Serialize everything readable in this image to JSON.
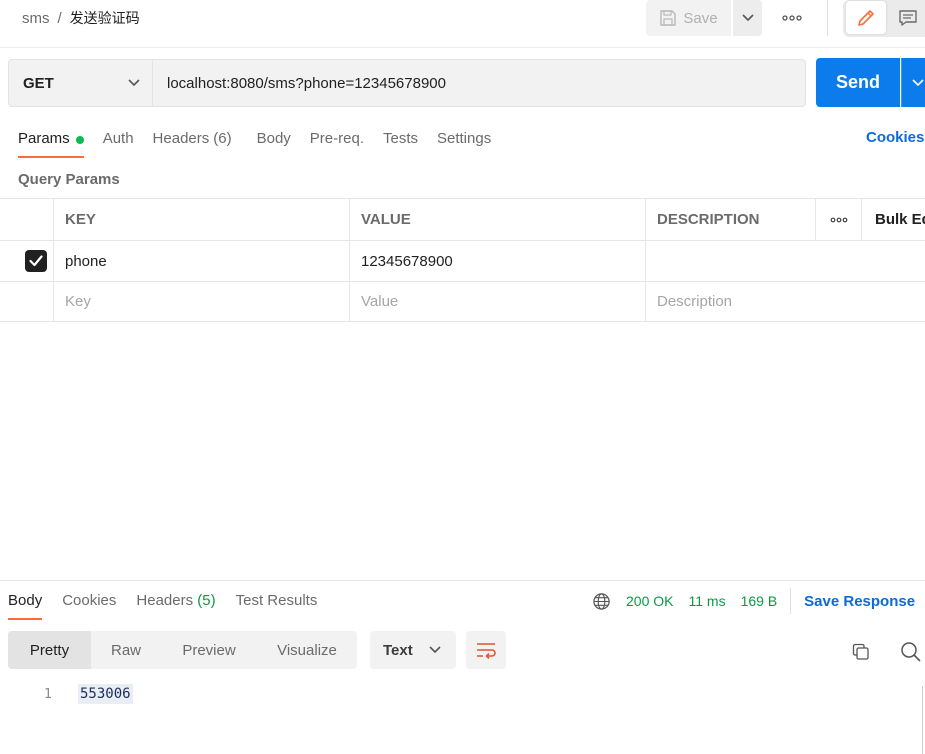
{
  "breadcrumb": {
    "parent": "sms",
    "separator": "/",
    "current": "发送验证码"
  },
  "toolbar": {
    "save_label": "Save"
  },
  "request": {
    "method": "GET",
    "url": "localhost:8080/sms?phone=12345678900",
    "send_label": "Send"
  },
  "req_tabs": {
    "params": "Params",
    "auth": "Auth",
    "headers": "Headers",
    "headers_count": "(6)",
    "body": "Body",
    "prereq": "Pre-req.",
    "tests": "Tests",
    "settings": "Settings",
    "cookies": "Cookies"
  },
  "query_params": {
    "title": "Query Params",
    "columns": {
      "key": "KEY",
      "value": "VALUE",
      "description": "DESCRIPTION",
      "bulk_edit": "Bulk Ed"
    },
    "rows": [
      {
        "checked": true,
        "key": "phone",
        "value": "12345678900",
        "description": ""
      }
    ],
    "placeholders": {
      "key": "Key",
      "value": "Value",
      "description": "Description"
    }
  },
  "response": {
    "tabs": {
      "body": "Body",
      "cookies": "Cookies",
      "headers": "Headers",
      "headers_count": "(5)",
      "test_results": "Test Results"
    },
    "status": "200 OK",
    "time": "11 ms",
    "size": "169 B",
    "save_response": "Save Response",
    "views": {
      "pretty": "Pretty",
      "raw": "Raw",
      "preview": "Preview",
      "visualize": "Visualize"
    },
    "format": "Text",
    "line_number": "1",
    "body_value": "553006"
  },
  "colors": {
    "accent": "#ff6c37",
    "primary": "#0c7cec",
    "success": "#0a9a45",
    "link": "#0c6bd8"
  }
}
